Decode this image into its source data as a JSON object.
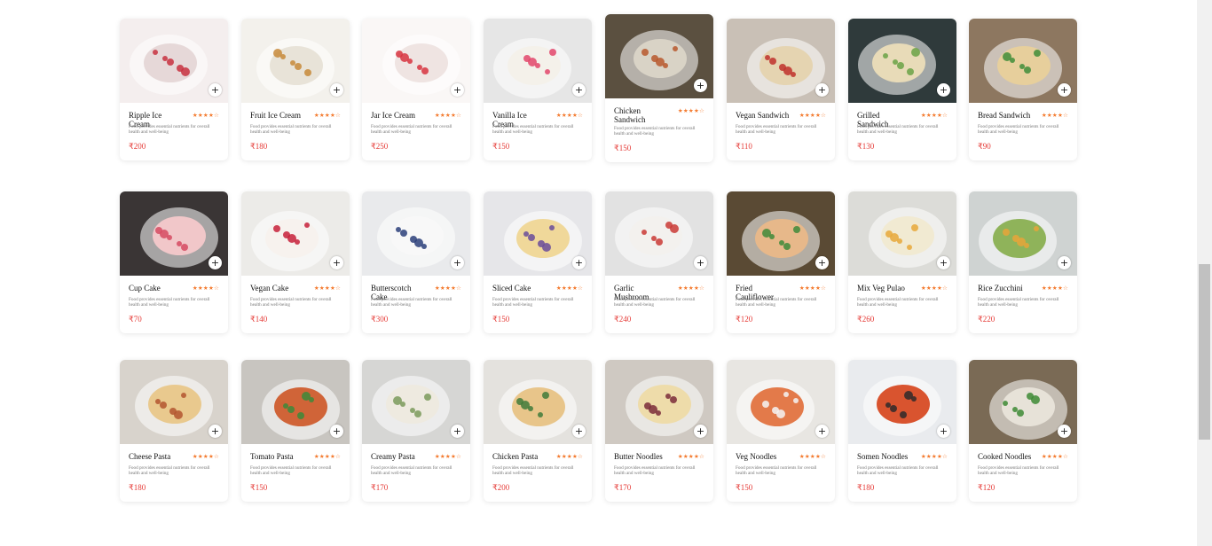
{
  "description_text": "Food provides essential nutrients for overall health and well-being",
  "add_symbol": "+",
  "colors": {
    "price": "#e53935",
    "stars": "#f47a2e"
  },
  "rows": [
    {
      "items": [
        {
          "name": "Ripple Ice Cream",
          "rating": "★★★★☆",
          "price": "₹200",
          "theme": [
            "#f4eeee",
            "#e6d8d8",
            "#c7313f"
          ]
        },
        {
          "name": "Fruit Ice Cream",
          "rating": "★★★★☆",
          "price": "₹180",
          "theme": [
            "#f3f1ec",
            "#e8e3d8",
            "#c78a3a"
          ]
        },
        {
          "name": "Jar Ice Cream",
          "rating": "★★★★☆",
          "price": "₹250",
          "theme": [
            "#faf7f6",
            "#efe4e2",
            "#d7343f"
          ]
        },
        {
          "name": "Vanilla Ice Cream",
          "rating": "★★★★☆",
          "price": "₹150",
          "theme": [
            "#e6e6e6",
            "#f4f1ea",
            "#e2476b"
          ]
        },
        {
          "name": "Chicken Sandwich",
          "rating": "★★★★☆",
          "price": "₹150",
          "theme": [
            "#5b5040",
            "#d9d3c6",
            "#b7582d"
          ]
        },
        {
          "name": "Vegan Sandwich",
          "rating": "★★★★☆",
          "price": "₹110",
          "theme": [
            "#c9c0b6",
            "#e5d4b1",
            "#c0302b"
          ]
        },
        {
          "name": "Grilled Sandwich",
          "rating": "★★★★☆",
          "price": "₹130",
          "theme": [
            "#2f3a3b",
            "#e8dbb8",
            "#6aa245"
          ]
        },
        {
          "name": "Bread Sandwich",
          "rating": "★★★★☆",
          "price": "₹90",
          "theme": [
            "#8d7760",
            "#e7cf9c",
            "#3f8d3a"
          ]
        }
      ]
    },
    {
      "items": [
        {
          "name": "Cup Cake",
          "rating": "★★★★☆",
          "price": "₹70",
          "theme": [
            "#3a3535",
            "#f1c7c9",
            "#d64a61"
          ]
        },
        {
          "name": "Vegan Cake",
          "rating": "★★★★☆",
          "price": "₹140",
          "theme": [
            "#ecebe8",
            "#f7f2ee",
            "#c7213a"
          ]
        },
        {
          "name": "Butterscotch Cake",
          "rating": "★★★★☆",
          "price": "₹300",
          "theme": [
            "#e9eaec",
            "#f8f8f8",
            "#2b3f7a"
          ]
        },
        {
          "name": "Sliced Cake",
          "rating": "★★★★☆",
          "price": "₹150",
          "theme": [
            "#e6e6e9",
            "#f0d89a",
            "#6a4c9a"
          ]
        },
        {
          "name": "Garlic Mushroom",
          "rating": "★★★★☆",
          "price": "₹240",
          "theme": [
            "#e2e2e2",
            "#f3f1ee",
            "#c93a35"
          ]
        },
        {
          "name": "Fried Cauliflower",
          "rating": "★★★★☆",
          "price": "₹120",
          "theme": [
            "#5a4a34",
            "#e7b88a",
            "#3e8a3a"
          ]
        },
        {
          "name": "Mix Veg Pulao",
          "rating": "★★★★☆",
          "price": "₹260",
          "theme": [
            "#dcdcd8",
            "#f1ead2",
            "#e8a83a"
          ]
        },
        {
          "name": "Rice Zucchini",
          "rating": "★★★★☆",
          "price": "₹220",
          "theme": [
            "#cfd3d2",
            "#8fb35a",
            "#e8a53a"
          ]
        }
      ]
    },
    {
      "items": [
        {
          "name": "Cheese Pasta",
          "rating": "★★★★☆",
          "price": "₹180",
          "theme": [
            "#d8d3cc",
            "#e9c98e",
            "#b3552f"
          ]
        },
        {
          "name": "Tomato Pasta",
          "rating": "★★★★☆",
          "price": "₹150",
          "theme": [
            "#c8c5c0",
            "#d06438",
            "#3c8a3a"
          ]
        },
        {
          "name": "Creamy Pasta",
          "rating": "★★★★☆",
          "price": "₹170",
          "theme": [
            "#d6d6d4",
            "#eeeae0",
            "#7a9a5a"
          ]
        },
        {
          "name": "Chicken Pasta",
          "rating": "★★★★☆",
          "price": "₹200",
          "theme": [
            "#e4e2de",
            "#e8c58a",
            "#3f7a3a"
          ]
        },
        {
          "name": "Butter Noodles",
          "rating": "★★★★☆",
          "price": "₹170",
          "theme": [
            "#cfc9c2",
            "#eedcaa",
            "#7a2c3a"
          ]
        },
        {
          "name": "Veg Noodles",
          "rating": "★★★★☆",
          "price": "₹150",
          "theme": [
            "#e8e6e2",
            "#e37a4a",
            "#f5f5f5"
          ]
        },
        {
          "name": "Somen Noodles",
          "rating": "★★★★☆",
          "price": "₹180",
          "theme": [
            "#e9ebee",
            "#d9542f",
            "#2e2a2a"
          ]
        },
        {
          "name": "Cooked Noodles",
          "rating": "★★★★☆",
          "price": "₹120",
          "theme": [
            "#7a6a55",
            "#e7e2d8",
            "#3d8a35"
          ]
        }
      ]
    }
  ]
}
